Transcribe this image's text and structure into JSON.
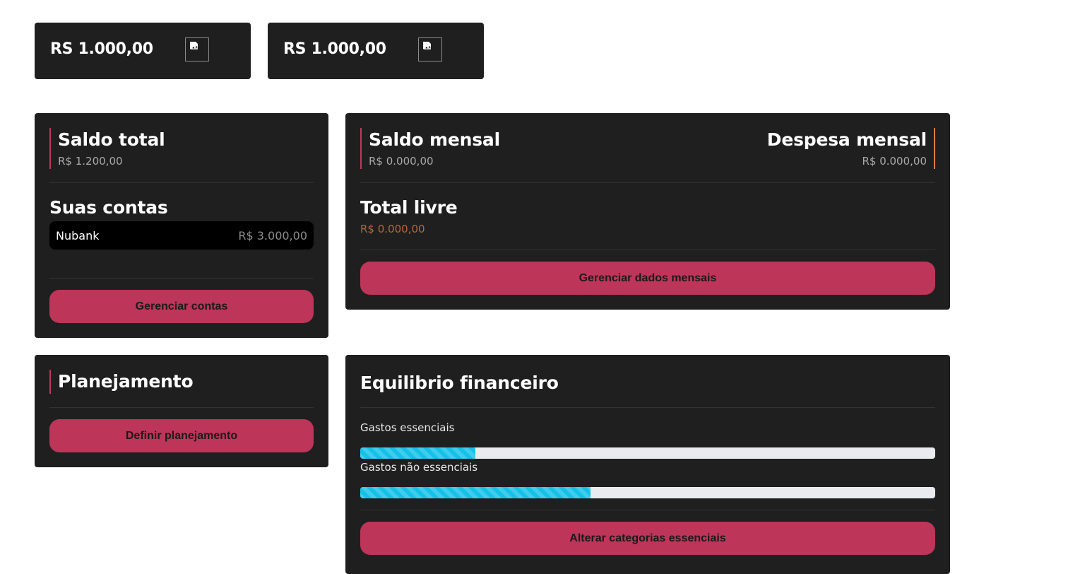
{
  "top_cards": [
    {
      "amount": "RS 1.000,00",
      "icon": "broken-image-icon"
    },
    {
      "amount": "RS 1.000,00",
      "icon": "broken-image-icon"
    }
  ],
  "saldo_total": {
    "title": "Saldo total",
    "value": "R$ 1.200,00",
    "accounts_title": "Suas contas",
    "accounts": [
      {
        "name": "Nubank",
        "balance": "R$ 3.000,00"
      }
    ],
    "button": "Gerenciar contas"
  },
  "mensal": {
    "saldo_title": "Saldo mensal",
    "saldo_value": "R$ 0.000,00",
    "despesa_title": "Despesa mensal",
    "despesa_value": "R$ 0.000,00",
    "livre_title": "Total livre",
    "livre_value": "R$ 0.000,00",
    "button": "Gerenciar dados mensais"
  },
  "planejamento": {
    "title": "Planejamento",
    "button": "Definir planejamento"
  },
  "equilibrio": {
    "title": "Equilibrio financeiro",
    "bars": [
      {
        "label": "Gastos essenciais",
        "percent": 20
      },
      {
        "label": "Gastos não essenciais",
        "percent": 40
      }
    ],
    "button": "Alterar categorias essenciais"
  },
  "colors": {
    "card_bg": "#1f1f1f",
    "accent": "#bd3559",
    "accent_secondary": "#e07a4a",
    "progress_fill": "#16c1e8",
    "progress_track": "#e9ecef"
  }
}
